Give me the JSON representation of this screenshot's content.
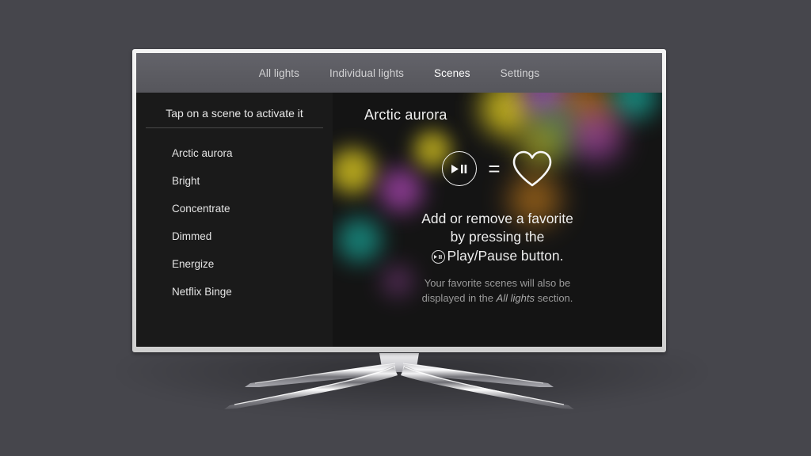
{
  "app": {
    "device": "television",
    "background_color": "#46464c",
    "screen_background": "#141414"
  },
  "nav": {
    "items": [
      {
        "label": "All lights",
        "active": false
      },
      {
        "label": "Individual lights",
        "active": false
      },
      {
        "label": "Scenes",
        "active": true
      },
      {
        "label": "Settings",
        "active": false
      }
    ]
  },
  "sidebar": {
    "hint": "Tap on a scene to activate it",
    "scenes": [
      {
        "label": "Arctic aurora"
      },
      {
        "label": "Bright"
      },
      {
        "label": "Concentrate"
      },
      {
        "label": "Dimmed"
      },
      {
        "label": "Energize"
      },
      {
        "label": "Netflix Binge"
      }
    ]
  },
  "main": {
    "scene_title": "Arctic aurora",
    "equation": {
      "play_pause_icon": "play-pause-icon",
      "equals": "=",
      "favorite_icon": "heart-outline-icon"
    },
    "instructions": {
      "line1": "Add or remove a favorite",
      "line2": "by pressing the",
      "line3_icon": "play-pause-icon",
      "line3": "Play/Pause button."
    },
    "footnote": {
      "part1": "Your favorite scenes will also be",
      "part2": "displayed in the",
      "emphasis": "All lights",
      "part3": "section."
    }
  },
  "bokeh_colors": {
    "yellow": "#d8c520",
    "magenta": "#b048b8",
    "teal": "#18a79a",
    "orange": "#d8871c",
    "purple": "#9a56c0",
    "green": "#4aa86a"
  }
}
